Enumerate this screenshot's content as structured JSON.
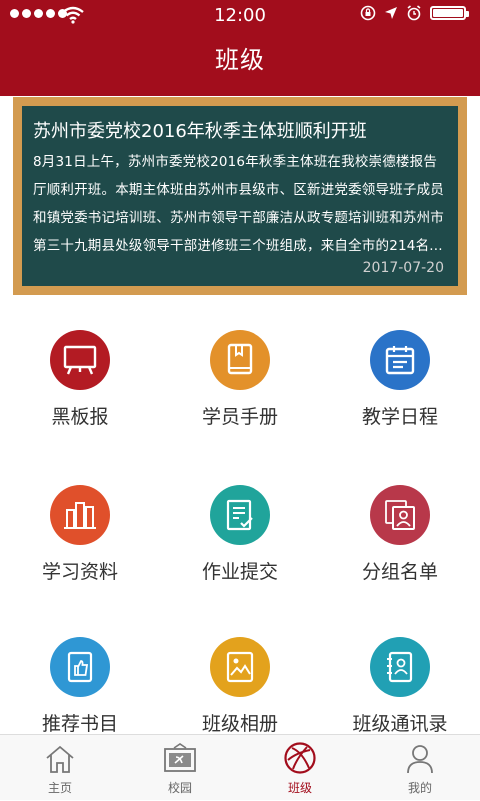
{
  "status_bar": {
    "time": "12:00",
    "battery_level": 1.0
  },
  "header": {
    "title": "班级"
  },
  "notice": {
    "title": "苏州市委党校2016年秋季主体班顺利开班",
    "body": "8月31日上午，苏州市委党校2016年秋季主体班在我校崇德楼报告厅顺利开班。本期主体班由苏州市县级市、区新进党委领导班子成员和镇党委书记培训班、苏州市领导干部廉洁从政专题培训班和苏州市第三十九期县处级领导干部进修班三个班组成，来自全市的214名...",
    "date": "2017-07-20"
  },
  "features": [
    {
      "label": "黑板报",
      "icon": "blackboard-icon",
      "color": "#b31b23"
    },
    {
      "label": "学员手册",
      "icon": "handbook-icon",
      "color": "#e3912a"
    },
    {
      "label": "教学日程",
      "icon": "calendar-icon",
      "color": "#2a73c8"
    },
    {
      "label": "学习资料",
      "icon": "books-icon",
      "color": "#e0502b"
    },
    {
      "label": "作业提交",
      "icon": "submit-document-icon",
      "color": "#20a49b"
    },
    {
      "label": "分组名单",
      "icon": "group-list-icon",
      "color": "#b8384a"
    },
    {
      "label": "推荐书目",
      "icon": "thumbs-up-book-icon",
      "color": "#2f97d4"
    },
    {
      "label": "班级相册",
      "icon": "photo-album-icon",
      "color": "#e3a21d"
    },
    {
      "label": "班级通讯录",
      "icon": "contacts-book-icon",
      "color": "#21a0b4"
    }
  ],
  "tabs": [
    {
      "label": "主页",
      "icon": "home-icon"
    },
    {
      "label": "校园",
      "icon": "campus-icon"
    },
    {
      "label": "班级",
      "icon": "class-icon",
      "active": true
    },
    {
      "label": "我的",
      "icon": "user-icon"
    }
  ],
  "colors": {
    "brand": "#a20d1c",
    "board": "#1f4a4a",
    "board_frame": "#d39b50"
  }
}
